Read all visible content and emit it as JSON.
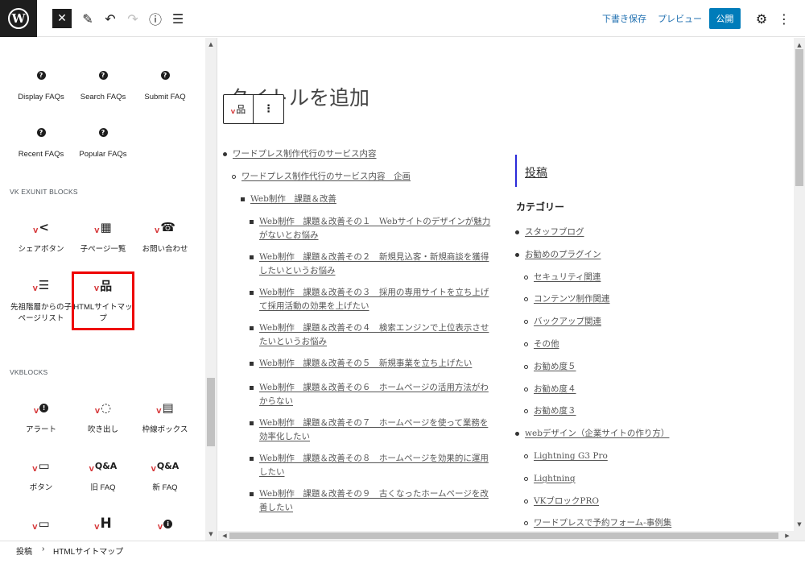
{
  "topbar": {
    "logo": "W",
    "close_icon": "✕",
    "edit_icon": "✎",
    "undo_icon": "↶",
    "redo_icon": "↷",
    "info_icon": "ⓘ",
    "list_icon": "☰",
    "save_draft": "下書き保存",
    "preview": "プレビュー",
    "publish": "公開",
    "settings_icon": "⚙",
    "more_icon": "⋮"
  },
  "sidebar": {
    "faq_blocks": [
      {
        "label": "Display FAQs",
        "icon": "question-circle"
      },
      {
        "label": "Search FAQs",
        "icon": "question-circle"
      },
      {
        "label": "Submit FAQ",
        "icon": "question-circle"
      },
      {
        "label": "Recent FAQs",
        "icon": "question-circle"
      },
      {
        "label": "Popular FAQs",
        "icon": "question-circle"
      }
    ],
    "vk_exunit": {
      "title": "VK EXUNIT BLOCKS",
      "blocks": [
        {
          "label": "シェアボタン",
          "icon": "share"
        },
        {
          "label": "子ページ一覧",
          "icon": "grid"
        },
        {
          "label": "お問い合わせ",
          "icon": "phone"
        },
        {
          "label": "先祖階層からの子ページリスト",
          "icon": "list"
        },
        {
          "label": "HTMLサイトマップ",
          "icon": "sitemap",
          "highlighted": true
        }
      ]
    },
    "vkblocks": {
      "title": "VKBLOCKS",
      "blocks": [
        {
          "label": "アラート",
          "icon": "alert"
        },
        {
          "label": "吹き出し",
          "icon": "balloon"
        },
        {
          "label": "枠線ボックス",
          "icon": "border-box"
        },
        {
          "label": "ボタン",
          "icon": "button"
        },
        {
          "label": "旧 FAQ",
          "icon": "faq-old"
        },
        {
          "label": "新 FAQ",
          "icon": "faq-new"
        },
        {
          "label": "",
          "icon": "dropdown"
        },
        {
          "label": "",
          "icon": "heading"
        },
        {
          "label": "",
          "icon": "info"
        }
      ]
    }
  },
  "editor": {
    "title_placeholder": "タイトルを追加",
    "block_toolbar": {
      "block_icon": "sitemap",
      "more_icon": "⋮"
    },
    "sitemap_pages": [
      {
        "level": 1,
        "text": "ワードプレス制作代行のサービス内容"
      },
      {
        "level": 2,
        "text": "ワードプレス制作代行のサービス内容　企画"
      },
      {
        "level": 3,
        "text": "Web制作　課題＆改善"
      },
      {
        "level": 4,
        "text": "Web制作　課題＆改善その１　Webサイトのデザインが魅力がないとお悩み"
      },
      {
        "level": 4,
        "text": "Web制作　課題＆改善その２　新規見込客・新規商談を獲得したいというお悩み"
      },
      {
        "level": 4,
        "text": "Web制作　課題＆改善その３　採用の専用サイトを立ち上げて採用活動の効果を上げたい"
      },
      {
        "level": 4,
        "text": "Web制作　課題＆改善その４　検索エンジンで上位表示させたいというお悩み"
      },
      {
        "level": 4,
        "text": "Web制作　課題＆改善その５　新規事業を立ち上げたい"
      },
      {
        "level": 4,
        "text": "Web制作　課題＆改善その６　ホームページの活用方法がわからない"
      },
      {
        "level": 4,
        "text": "Web制作　課題＆改善その７　ホームページを使って業務を効率化したい"
      },
      {
        "level": 4,
        "text": "Web制作　課題＆改善その８　ホームページを効果的に運用したい"
      },
      {
        "level": 4,
        "text": "Web制作　課題＆改善その９　古くなったホームページを改善したい"
      }
    ],
    "posts_heading": "投稿",
    "category_heading": "カテゴリー",
    "categories": [
      {
        "level": 1,
        "text": "スタッフブログ"
      },
      {
        "level": 1,
        "text": "お勧めのプラグイン"
      },
      {
        "level": 2,
        "text": "セキュリティ関連"
      },
      {
        "level": 2,
        "text": "コンテンツ制作関連"
      },
      {
        "level": 2,
        "text": "バックアップ関連"
      },
      {
        "level": 2,
        "text": "その他"
      },
      {
        "level": 2,
        "text": "お勧め度５"
      },
      {
        "level": 2,
        "text": "お勧め度４"
      },
      {
        "level": 2,
        "text": "お勧め度３"
      },
      {
        "level": 1,
        "text": "webデザイン（企業サイトの作り方）"
      },
      {
        "level": 2,
        "text": "Lightning G3 Pro"
      },
      {
        "level": 2,
        "text": "Lightning"
      },
      {
        "level": 2,
        "text": "VKブロックPRO"
      },
      {
        "level": 2,
        "text": "ワードプレスで予約フォーム-事例集"
      }
    ]
  },
  "footer": {
    "breadcrumb": [
      "投稿",
      "HTMLサイトマップ"
    ],
    "separator": "›"
  }
}
